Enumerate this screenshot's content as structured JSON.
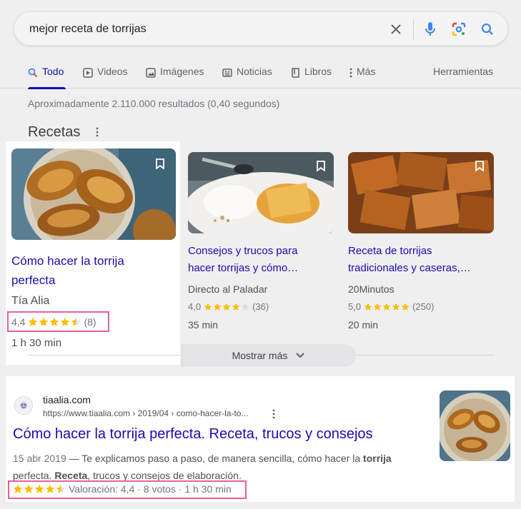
{
  "search": {
    "query": "mejor receta de torrijas",
    "clear_icon": "close-icon",
    "mic_icon": "mic-icon",
    "lens_icon": "lens-icon",
    "search_icon": "search-icon"
  },
  "tabs": [
    {
      "label": "Todo",
      "icon": "search-icon",
      "active": true
    },
    {
      "label": "Videos",
      "icon": "play-icon"
    },
    {
      "label": "Imágenes",
      "icon": "image-icon"
    },
    {
      "label": "Noticias",
      "icon": "news-icon"
    },
    {
      "label": "Libros",
      "icon": "book-icon"
    },
    {
      "label": "Más",
      "icon": "more-vert-icon"
    }
  ],
  "tools_label": "Herramientas",
  "result_stats": "Aproximadamente 2.110.000 resultados (0,40 segundos)",
  "recipes": {
    "heading": "Recetas",
    "cards": [
      {
        "title_line1": "Cómo hacer la torrija",
        "title_line2": "perfecta",
        "source": "Tía Alia",
        "rating": "4,4",
        "stars": 4.5,
        "count": "(8)",
        "duration": "1 h 30 min"
      },
      {
        "title_line1": "Consejos y trucos para",
        "title_line2": "hacer torrijas y cómo…",
        "source": "Directo al Paladar",
        "rating": "4,0",
        "stars": 4,
        "count": "(36)",
        "duration": "35 min"
      },
      {
        "title_line1": "Receta de torrijas",
        "title_line2": "tradicionales y caseras,…",
        "source": "20Minutos",
        "rating": "5,0",
        "stars": 5,
        "count": "(250)",
        "duration": "20 min"
      }
    ],
    "show_more": "Mostrar más"
  },
  "result": {
    "site_name": "tiaalia.com",
    "url": "https://www.tiaalia.com › 2019/04 › como-hacer-la-to...",
    "title": "Cómo hacer la torrija perfecta. Receta, trucos y consejos",
    "date": "15 abr 2019",
    "snippet_a": " — Te explicamos paso a paso, de manera sencilla, cómo hacer la ",
    "snippet_b1": "torrija",
    "snippet_c": "perfecta. ",
    "snippet_b2": "Receta",
    "snippet_d": ", trucos y consejos de elaboración.",
    "stars": 4.5,
    "meta": "Valoración: 4,4 · 8 votos · 1 h 30 min"
  },
  "colors": {
    "link": "#1a0dab",
    "star": "#fbbc04",
    "highlight": "#e5609b"
  }
}
